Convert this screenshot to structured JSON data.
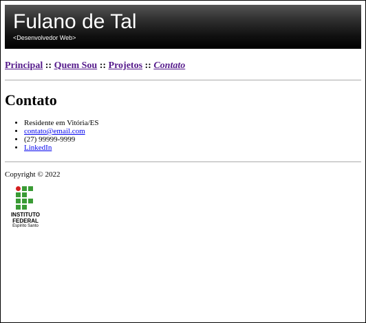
{
  "header": {
    "title": "Fulano de Tal",
    "subtitle": "<Desenvolvedor Web>"
  },
  "nav": {
    "items": [
      {
        "label": "Principal"
      },
      {
        "label": "Quem Sou"
      },
      {
        "label": "Projetos"
      },
      {
        "label": "Contato",
        "active": true
      }
    ],
    "separator": "::"
  },
  "main": {
    "heading": "Contato",
    "items": [
      "Residente em Vitória/ES",
      "contato@email.com",
      "(27) 99999-9999",
      "LinkedIn"
    ]
  },
  "footer": {
    "copyright": "Copyright © 2022",
    "logo_line1": "INSTITUTO",
    "logo_line2": "FEDERAL",
    "logo_line3": "Espírito Santo"
  },
  "colors": {
    "visited_link": "#551a8b",
    "link": "#0000ee",
    "logo_red": "#d42020",
    "logo_green": "#3a9b35"
  }
}
